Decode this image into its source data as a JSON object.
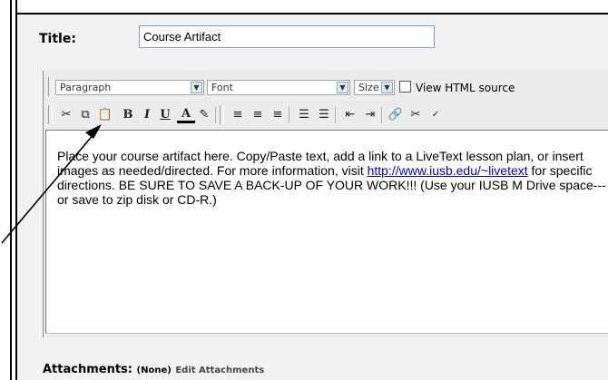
{
  "form": {
    "title_label": "Title:",
    "title_value": "Course Artifact"
  },
  "toolbar": {
    "paragraph_select": "Paragraph",
    "font_select": "Font",
    "size_select": "Size",
    "view_html_source_label": "View HTML source",
    "bold_label": "B",
    "italic_label": "I",
    "underline_label": "U",
    "font_color_label": "A"
  },
  "editor": {
    "text_1": "Place your course artifact here.  Copy/Paste text, add a link to a LiveText lesson plan, or insert images as needed/directed.  For more information, visit ",
    "link": "http://www.iusb.edu/~livetext",
    "text_2": " for specific directions.  BE SURE TO SAVE A BACK-UP OF YOUR WORK!!!  (Use your IUSB M Drive space---or save to zip disk or CD-R.)"
  },
  "attachments": {
    "label": "Attachments:",
    "none": "(None)",
    "edit": "Edit Attachments"
  },
  "icons": [
    "cut-icon",
    "copy-icon",
    "paste-icon",
    "align-left-icon",
    "align-center-icon",
    "align-right-icon",
    "numbered-list-icon",
    "bullet-list-icon",
    "outdent-icon",
    "indent-icon",
    "link-icon",
    "unlink-icon",
    "spellcheck-icon"
  ],
  "colors": {
    "panel": "#f2f2f2",
    "link": "#0000cc",
    "frame": "#000000"
  }
}
